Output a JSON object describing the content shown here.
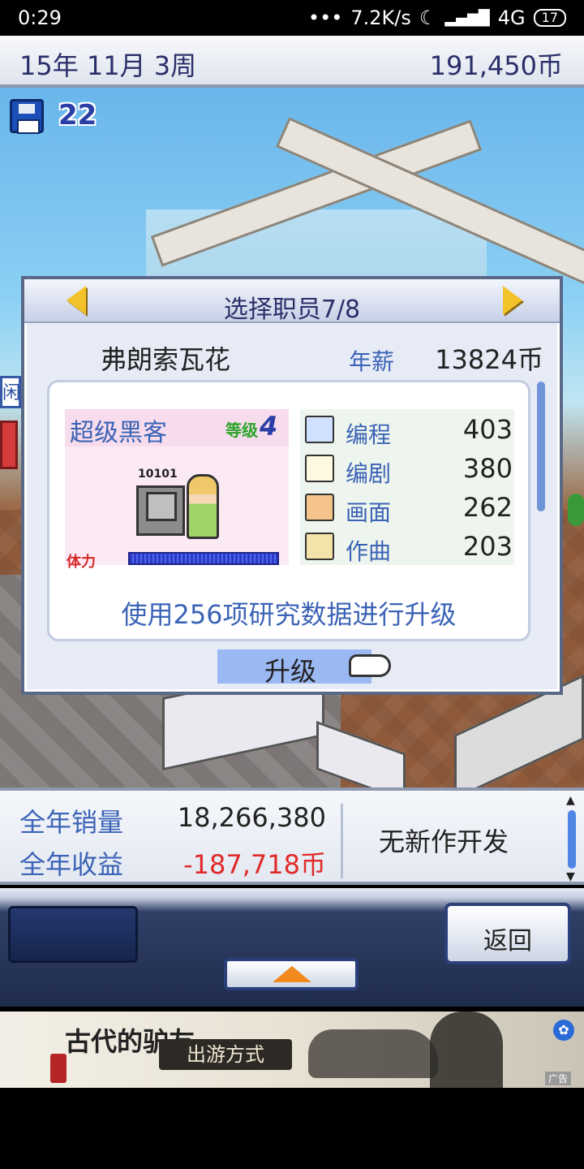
{
  "status_bar": {
    "time": "0:29",
    "signal_text": "•••",
    "network_speed": "7.2K/s",
    "moon_icon": "moon-icon",
    "signal_icon": "signal-bars-icon",
    "network": "4G",
    "battery": "17"
  },
  "top_bar": {
    "date": "15年 11月 3周",
    "money": "191,450币"
  },
  "save": {
    "icon": "floppy-disk-icon",
    "count": "22"
  },
  "side_sign": "闲",
  "dialog": {
    "title": "选择职员7/8",
    "employee_name": "弗朗索瓦花",
    "salary_label": "年薪",
    "salary_value": "13824币",
    "job_title": "超级黑客",
    "level_label": "等级",
    "level_value": "4",
    "binary_text": "10101",
    "stamina_label": "体力",
    "stats": [
      {
        "icon": "computer-icon",
        "label": "编程",
        "value": "403"
      },
      {
        "icon": "book-pen-icon",
        "label": "编剧",
        "value": "380"
      },
      {
        "icon": "palette-icon",
        "label": "画面",
        "value": "262"
      },
      {
        "icon": "music-key-icon",
        "label": "作曲",
        "value": "203"
      }
    ],
    "upgrade_text": "使用256项研究数据进行升级",
    "upgrade_button": "升级"
  },
  "sales": {
    "annual_sales_label": "全年销量",
    "annual_sales_value": "18,266,380",
    "annual_revenue_label": "全年收益",
    "annual_revenue_value": "-187,718币",
    "no_dev_text": "无新作开发"
  },
  "controls": {
    "back_button": "返回"
  },
  "ad": {
    "title": "古代的驴友",
    "button": "出游方式",
    "label": "广告"
  },
  "colors": {
    "accent_blue": "#3b63b6",
    "negative_red": "#e02a2a",
    "title_navy": "#2b2f6a"
  }
}
